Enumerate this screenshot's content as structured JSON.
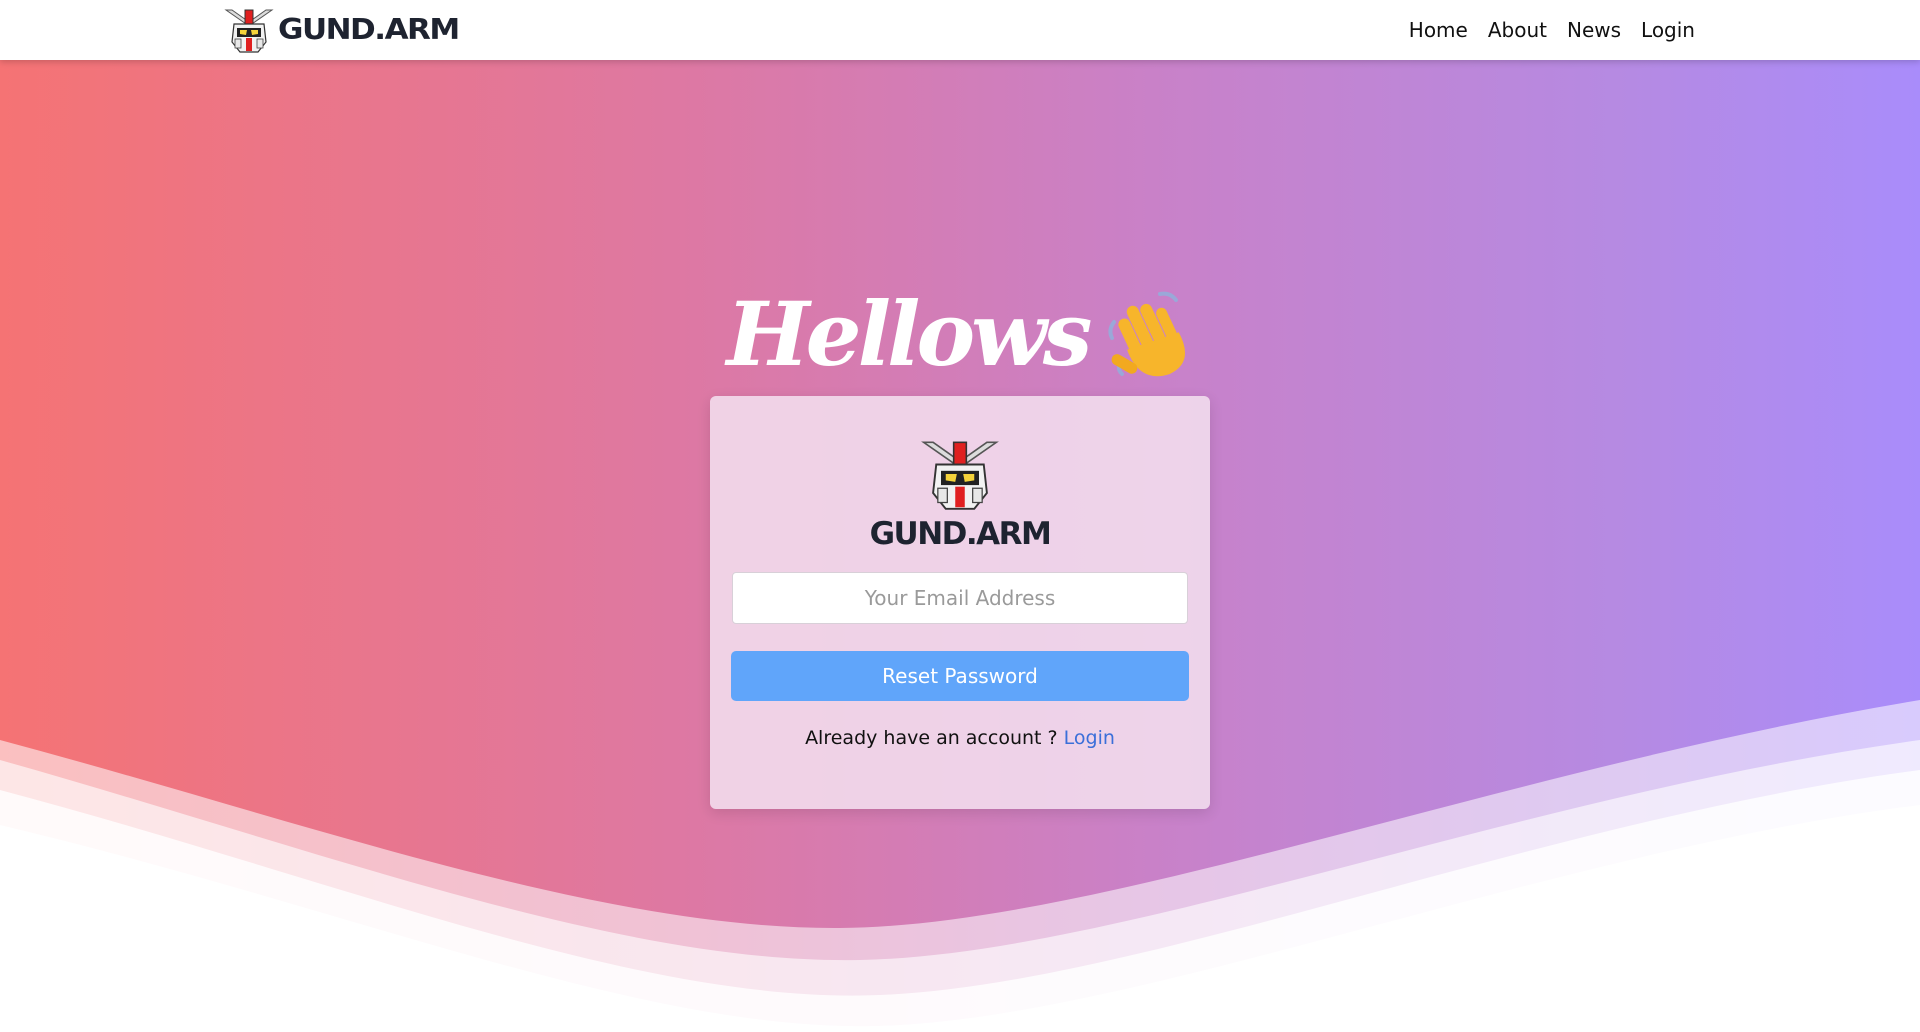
{
  "navbar": {
    "brand": "GUND.ARM",
    "links": [
      {
        "label": "Home"
      },
      {
        "label": "About"
      },
      {
        "label": "News"
      },
      {
        "label": "Login"
      }
    ]
  },
  "hero": {
    "heading": "Hellows",
    "heading_emoji": "waving-hand-icon"
  },
  "card": {
    "brand": "GUND.ARM",
    "email": {
      "placeholder": "Your Email Address",
      "value": ""
    },
    "reset_button": "Reset Password",
    "account_prompt": "Already have an account ?",
    "login_link": "Login"
  },
  "colors": {
    "gradient_left": "#f57374",
    "gradient_right": "#a98cfb",
    "button": "#60a5fa",
    "link": "#3b6fd9",
    "brand_text": "#1e2330"
  }
}
